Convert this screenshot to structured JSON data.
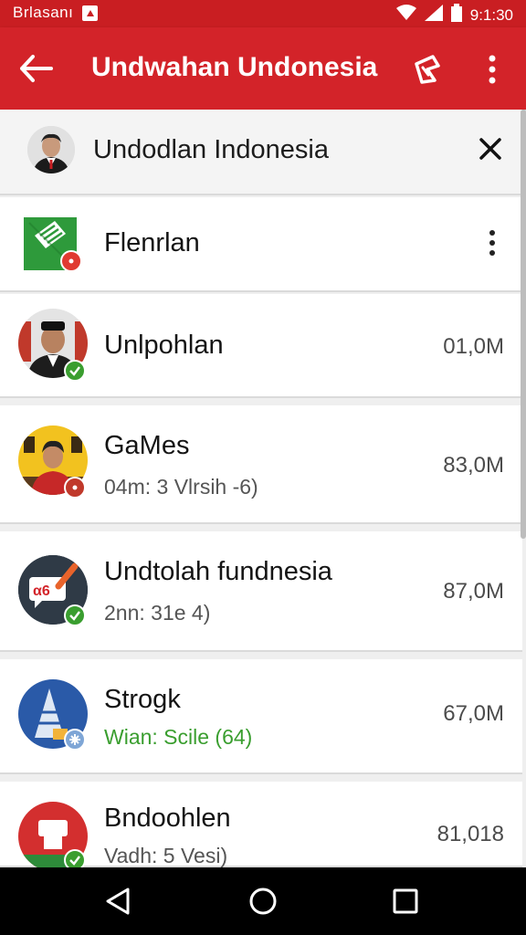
{
  "status_bar": {
    "carrier": "Brlasanı",
    "time": "9:1:30"
  },
  "app_bar": {
    "title": "Undwahan Undonesia"
  },
  "search": {
    "query": "Undodlan Indonesia"
  },
  "rows": [
    {
      "title": "Flenrlan",
      "subtitle": "",
      "size": ""
    },
    {
      "title": "Unlpohlan",
      "subtitle": "",
      "size": "01,0M"
    },
    {
      "title": "GaMes",
      "subtitle": "04m: 3 Vlrsih -6)",
      "size": "83,0M"
    },
    {
      "title": "Undtolah fundnesia",
      "subtitle": "2nn: 31e 4)",
      "size": "87,0M"
    },
    {
      "title": "Strogk",
      "subtitle": "Wian: Scile (64)",
      "size": "67,0M"
    },
    {
      "title": "Bndoohlen",
      "subtitle": "Vadh: 5 Vesi)",
      "size": "81,018"
    }
  ],
  "colors": {
    "brand_red": "#d32329",
    "status_red": "#c91e22",
    "ok_green": "#3a9e2f"
  },
  "icons": [
    "back-arrow-icon",
    "share-icon",
    "more-vert-icon",
    "close-icon",
    "nav-back-icon",
    "nav-home-icon",
    "nav-recents-icon"
  ]
}
